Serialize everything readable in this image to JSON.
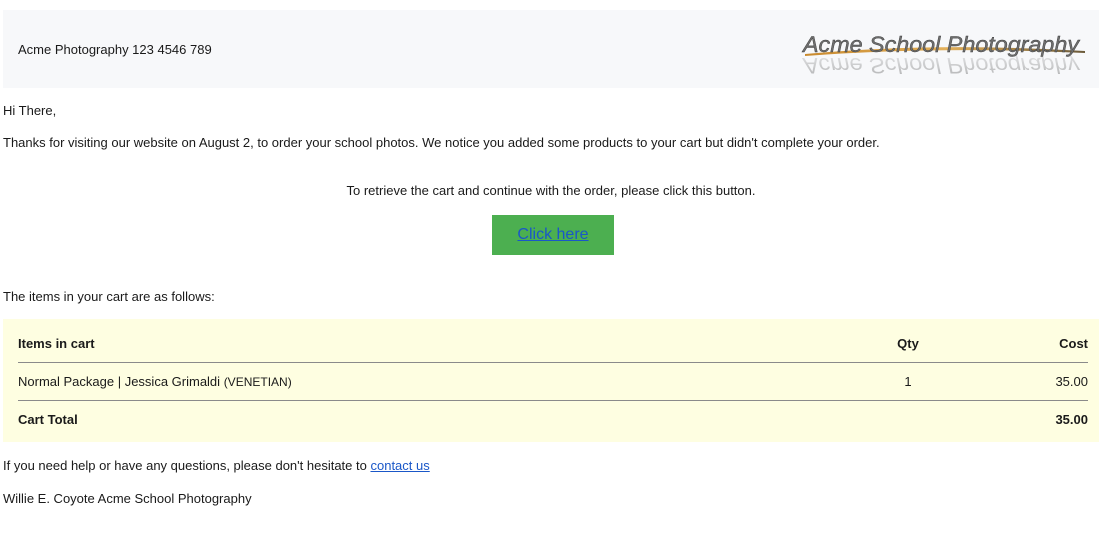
{
  "header": {
    "contact": "Acme Photography 123 4546 789",
    "logo_text": "Acme School Photography"
  },
  "greeting": "Hi There,",
  "intro": "Thanks for visiting our website on August 2, to order your school photos. We notice you added some products to your cart but didn't complete your order.",
  "retrieve_text": "To retrieve the cart and continue with the order, please click this button.",
  "cta": {
    "label": "Click here"
  },
  "items_intro": "The items in your cart are as follows:",
  "cart": {
    "headers": {
      "item": "Items in cart",
      "qty": "Qty",
      "cost": "Cost"
    },
    "items": [
      {
        "name": "Normal Package | Jessica Grimaldi",
        "variant": "(VENETIAN)",
        "qty": "1",
        "cost": "35.00"
      }
    ],
    "total_label": "Cart Total",
    "total_value": "35.00"
  },
  "help": {
    "text": "If you need help or have any questions, please don't hesitate to",
    "link": "contact us"
  },
  "signature": "Willie E. Coyote Acme School Photography",
  "colors": {
    "header_bg": "#f7f8fa",
    "cart_bg": "#fefee1",
    "button_bg": "#4caf50",
    "link": "#1a57c8"
  }
}
